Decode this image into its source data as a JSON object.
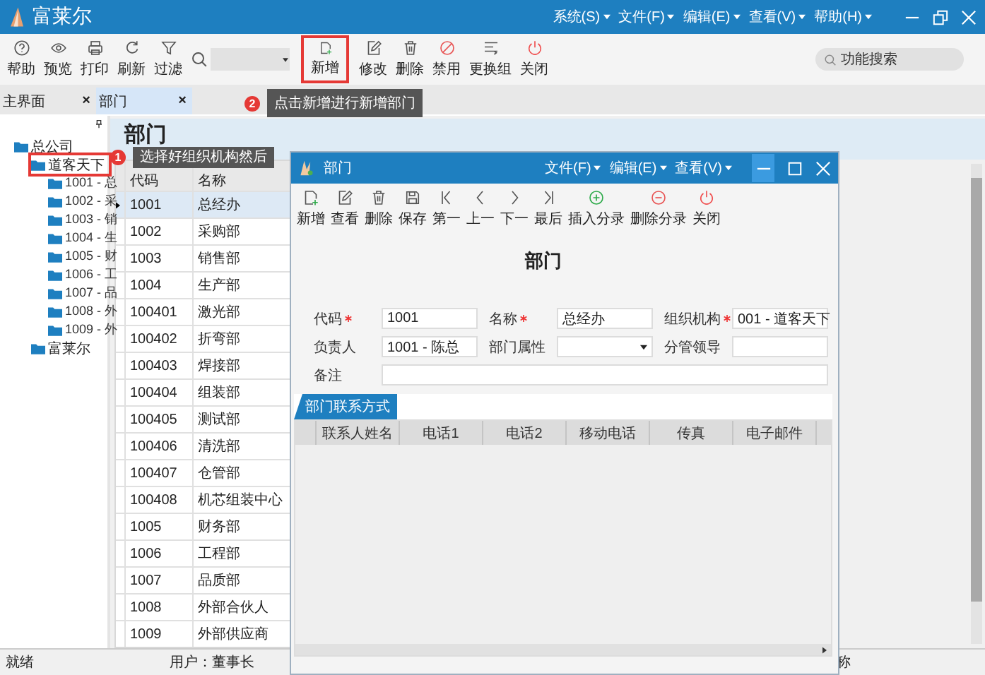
{
  "window": {
    "title": "富莱尔",
    "menus": [
      "系统(S)",
      "文件(F)",
      "编辑(E)",
      "查看(V)",
      "帮助(H)"
    ]
  },
  "toolbar": {
    "groups": [
      [
        {
          "label": "帮助",
          "kind": "help",
          "highlighted": false
        },
        {
          "label": "预览",
          "kind": "eye",
          "highlighted": false
        },
        {
          "label": "打印",
          "kind": "printer",
          "highlighted": false
        },
        {
          "label": "刷新",
          "kind": "refresh",
          "highlighted": false
        },
        {
          "label": "过滤",
          "kind": "filter",
          "highlighted": false
        }
      ],
      [
        {
          "label": "新增",
          "kind": "new",
          "highlighted": true
        },
        {
          "label": "修改",
          "kind": "edit",
          "highlighted": false
        },
        {
          "label": "删除",
          "kind": "trash",
          "highlighted": false
        },
        {
          "label": "禁用",
          "kind": "ban",
          "highlighted": false
        },
        {
          "label": "更换组",
          "kind": "list",
          "highlighted": false
        },
        {
          "label": "关闭",
          "kind": "power",
          "highlighted": false
        }
      ]
    ],
    "search": {
      "placeholder": "功能搜索"
    }
  },
  "tabs": [
    {
      "label": "主界面",
      "close": "×",
      "selected": false
    },
    {
      "label": "部门",
      "close": "×",
      "selected": true
    }
  ],
  "callouts": [
    {
      "number": "1",
      "text": "选择好组织机构然后"
    },
    {
      "number": "2",
      "text": "点击新增进行新增部门"
    }
  ],
  "page_title": "部门",
  "tree": {
    "items": [
      {
        "label": "总公司",
        "highlighted": false,
        "children": [
          {
            "label": "道客天下",
            "highlighted": true,
            "children": [
              {
                "label": "1001 - 总",
                "highlighted": false
              },
              {
                "label": "1002 - 采",
                "highlighted": false
              },
              {
                "label": "1003 - 销",
                "highlighted": false
              },
              {
                "label": "1004 - 生",
                "highlighted": false
              },
              {
                "label": "1005 - 财",
                "highlighted": false
              },
              {
                "label": "1006 - 工",
                "highlighted": false
              },
              {
                "label": "1007 - 品",
                "highlighted": false
              },
              {
                "label": "1008 - 外",
                "highlighted": false
              },
              {
                "label": "1009 - 外",
                "highlighted": false
              }
            ]
          },
          {
            "label": "富莱尔",
            "highlighted": false
          }
        ]
      }
    ]
  },
  "grid": {
    "columns": [
      "代码",
      "名称"
    ],
    "rows": [
      {
        "code": "1001",
        "name": "总经办",
        "selected": true
      },
      {
        "code": "1002",
        "name": "采购部",
        "selected": false
      },
      {
        "code": "1003",
        "name": "销售部",
        "selected": false
      },
      {
        "code": "1004",
        "name": "生产部",
        "selected": false
      },
      {
        "code": "100401",
        "name": "激光部",
        "selected": false
      },
      {
        "code": "100402",
        "name": "折弯部",
        "selected": false
      },
      {
        "code": "100403",
        "name": "焊接部",
        "selected": false
      },
      {
        "code": "100404",
        "name": "组装部",
        "selected": false
      },
      {
        "code": "100405",
        "name": "测试部",
        "selected": false
      },
      {
        "code": "100406",
        "name": "清洗部",
        "selected": false
      },
      {
        "code": "100407",
        "name": "仓管部",
        "selected": false
      },
      {
        "code": "100408",
        "name": "机芯组装中心",
        "selected": false
      },
      {
        "code": "1005",
        "name": "财务部",
        "selected": false
      },
      {
        "code": "1006",
        "name": "工程部",
        "selected": false
      },
      {
        "code": "1007",
        "name": "品质部",
        "selected": false
      },
      {
        "code": "1008",
        "name": "外部合伙人",
        "selected": false
      },
      {
        "code": "1009",
        "name": "外部供应商",
        "selected": false
      }
    ]
  },
  "status_bar": {
    "state": "就绪",
    "user": "用户：董事长",
    "right_text": "称"
  },
  "dialog": {
    "title": "部门",
    "menus": [
      "文件(F)",
      "编辑(E)",
      "查看(V)"
    ],
    "toolbar": [
      {
        "label": "新增",
        "kind": "new"
      },
      {
        "label": "查看",
        "kind": "edit"
      },
      {
        "label": "删除",
        "kind": "trash"
      },
      {
        "label": "保存",
        "kind": "save"
      },
      {
        "label": "第一",
        "kind": "first"
      },
      {
        "label": "上一",
        "kind": "prev"
      },
      {
        "label": "下一",
        "kind": "next"
      },
      {
        "label": "最后",
        "kind": "last"
      },
      {
        "label": "插入分录",
        "kind": "plus"
      },
      {
        "label": "删除分录",
        "kind": "minus"
      },
      {
        "label": "关闭",
        "kind": "power"
      }
    ],
    "heading": "部门",
    "form_rows": [
      [
        {
          "label": "代码",
          "required": true,
          "kind": "text",
          "value": "1001"
        },
        {
          "label": "名称",
          "required": true,
          "kind": "text",
          "value": "总经办"
        },
        {
          "label": "组织机构",
          "required": true,
          "kind": "select",
          "value": "001 - 道客天下"
        }
      ],
      [
        {
          "label": "负责人",
          "required": false,
          "kind": "text",
          "value": "1001 - 陈总"
        },
        {
          "label": "部门属性",
          "required": false,
          "kind": "select"
        },
        {
          "label": "分管领导",
          "required": false,
          "kind": "text"
        }
      ],
      [
        {
          "label": "备注",
          "required": false,
          "kind": "text"
        }
      ]
    ],
    "tabs": [
      {
        "label": "部门联系方式",
        "selected": true
      }
    ],
    "table": {
      "columns": [
        "联系人姓名",
        "电话1",
        "电话2",
        "移动电话",
        "传真",
        "电子邮件"
      ]
    }
  }
}
